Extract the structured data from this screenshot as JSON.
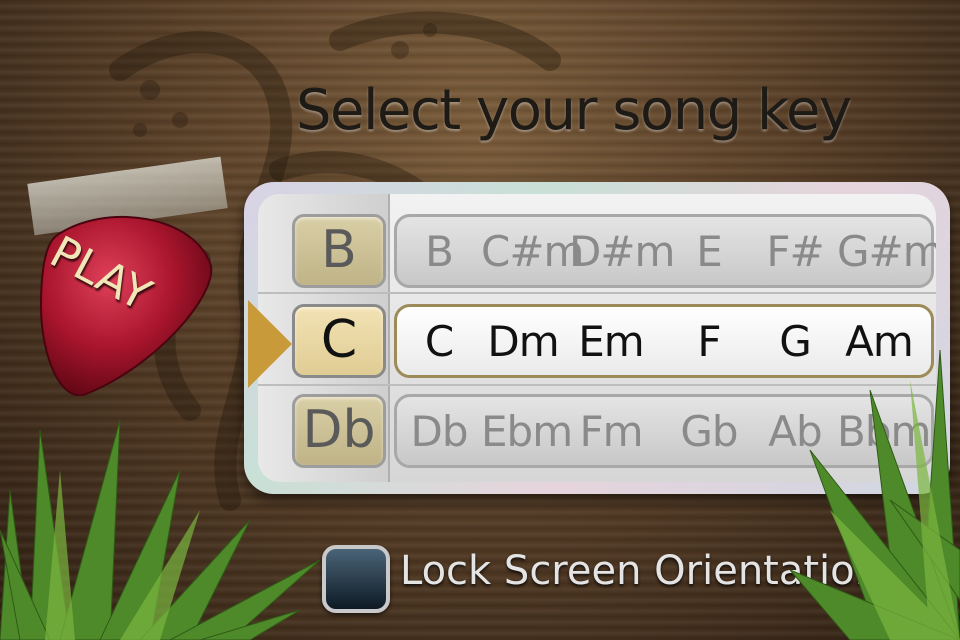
{
  "title": "Select your song key",
  "play_button": {
    "label": "PLAY",
    "icon": "guitar-pick-icon"
  },
  "keys": [
    {
      "key": "B",
      "selected": false,
      "chords": [
        "B",
        "C#m",
        "D#m",
        "E",
        "F#",
        "G#m"
      ]
    },
    {
      "key": "C",
      "selected": true,
      "chords": [
        "C",
        "Dm",
        "Em",
        "F",
        "G",
        "Am"
      ]
    },
    {
      "key": "Db",
      "selected": false,
      "chords": [
        "Db",
        "Ebm",
        "Fm",
        "Gb",
        "Ab",
        "Bbm"
      ]
    }
  ],
  "lock_orientation": {
    "label": "Lock Screen Orientation",
    "checked": false
  },
  "colors": {
    "selected_key": "#e0cc94",
    "pick": "#a8152c",
    "pointer": "#c99a3a"
  }
}
